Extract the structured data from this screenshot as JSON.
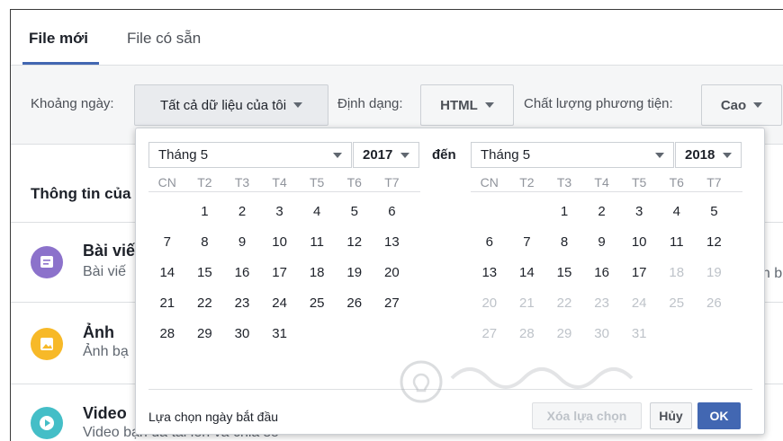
{
  "tabs": [
    {
      "label": "File mới",
      "active": true
    },
    {
      "label": "File có sẵn",
      "active": false
    }
  ],
  "toolbar": {
    "range_label": "Khoảng ngày:",
    "range_value": "Tất cả dữ liệu của tôi",
    "format_label": "Định dạng:",
    "format_value": "HTML",
    "quality_label": "Chất lượng phương tiện:",
    "quality_value": "Cao"
  },
  "background": {
    "section_title": "Thông tin của",
    "items": [
      {
        "title": "Bài viế",
        "subtitle": "Bài viế",
        "icon": "posts-icon",
        "color": "#8c72cb"
      },
      {
        "title": "Ảnh",
        "subtitle": "Ảnh bạ",
        "icon": "photo-icon",
        "color": "#f7b928"
      },
      {
        "title": "Video",
        "subtitle": "Video bạn đã tải lên và chia sẻ",
        "icon": "video-icon",
        "color": "#44bec7"
      }
    ],
    "right_fragment": "ến b"
  },
  "datepicker": {
    "from_month": "Tháng 5",
    "from_year": "2017",
    "to_label": "đến",
    "to_month": "Tháng 5",
    "to_year": "2018",
    "weekdays": [
      "CN",
      "T2",
      "T3",
      "T4",
      "T5",
      "T6",
      "T7"
    ],
    "from_days": [
      [
        "",
        "1",
        "2",
        "3",
        "4",
        "5",
        "6"
      ],
      [
        "7",
        "8",
        "9",
        "10",
        "11",
        "12",
        "13"
      ],
      [
        "14",
        "15",
        "16",
        "17",
        "18",
        "19",
        "20"
      ],
      [
        "21",
        "22",
        "23",
        "24",
        "25",
        "26",
        "27"
      ],
      [
        "28",
        "29",
        "30",
        "31",
        "",
        "",
        ""
      ]
    ],
    "to_days": [
      [
        "",
        "",
        "1",
        "2",
        "3",
        "4",
        "5"
      ],
      [
        "6",
        "7",
        "8",
        "9",
        "10",
        "11",
        "12"
      ],
      [
        "13",
        "14",
        "15",
        "16",
        "17",
        "18",
        "19"
      ],
      [
        "20",
        "21",
        "22",
        "23",
        "24",
        "25",
        "26"
      ],
      [
        "27",
        "28",
        "29",
        "30",
        "31",
        "",
        ""
      ]
    ],
    "to_disabled_from": 18,
    "hint": "Lựa chọn ngày bắt đầu",
    "clear_label": "Xóa lựa chọn",
    "cancel_label": "Hủy",
    "ok_label": "OK"
  },
  "colors": {
    "accent": "#4267b2",
    "disabled_text": "#bec3c9"
  }
}
